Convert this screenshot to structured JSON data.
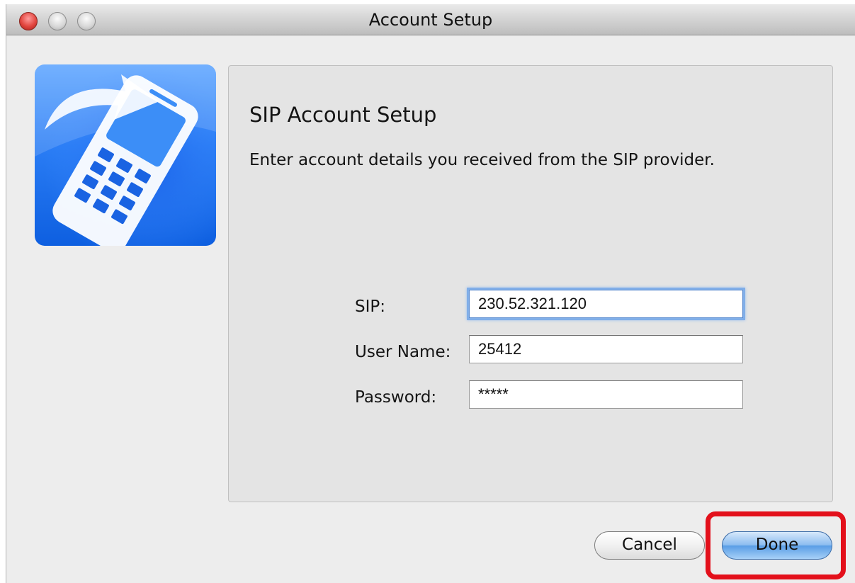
{
  "window": {
    "title": "Account Setup"
  },
  "app_icon": {
    "name": "sip-phone-app-icon",
    "colors": [
      "#1a6ff0",
      "#4a9bff",
      "#ffffff"
    ]
  },
  "panel": {
    "heading": "SIP Account Setup",
    "instructions": "Enter account details you received from the SIP provider."
  },
  "form": {
    "sip": {
      "label": "SIP:",
      "value": "230.52.321.120"
    },
    "username": {
      "label": "User Name:",
      "value": "25412"
    },
    "password": {
      "label": "Password:",
      "value": "*****"
    }
  },
  "buttons": {
    "cancel": "Cancel",
    "done": "Done"
  },
  "highlight_color": "#e3101b"
}
